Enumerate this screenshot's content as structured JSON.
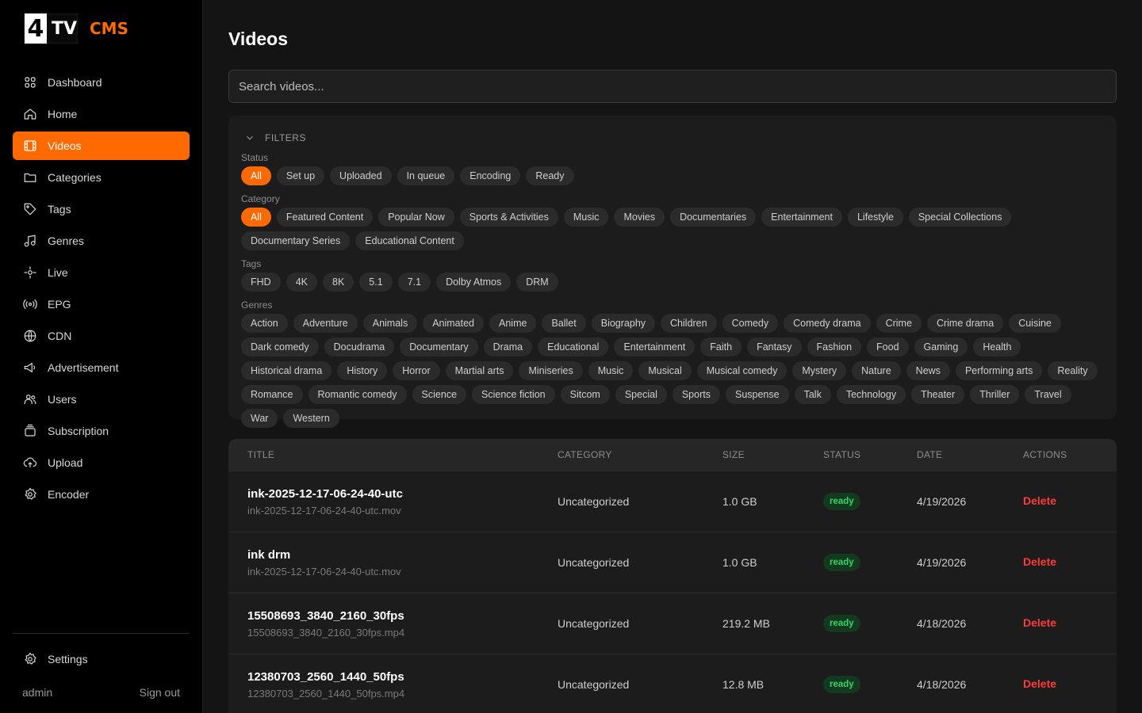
{
  "logo": {
    "mark": "4",
    "tv": "TV",
    "cms": "CMS"
  },
  "sidebar": {
    "items": [
      {
        "label": "Dashboard",
        "icon": "grid-icon",
        "active": false
      },
      {
        "label": "Home",
        "icon": "home-icon",
        "active": false
      },
      {
        "label": "Videos",
        "icon": "film-icon",
        "active": true
      },
      {
        "label": "Categories",
        "icon": "folder-icon",
        "active": false
      },
      {
        "label": "Tags",
        "icon": "tag-icon",
        "active": false
      },
      {
        "label": "Genres",
        "icon": "music-note-icon",
        "active": false
      },
      {
        "label": "Live",
        "icon": "live-signal-icon",
        "active": false
      },
      {
        "label": "EPG",
        "icon": "broadcast-icon",
        "active": false
      },
      {
        "label": "CDN",
        "icon": "globe-icon",
        "active": false
      },
      {
        "label": "Advertisement",
        "icon": "megaphone-icon",
        "active": false
      },
      {
        "label": "Users",
        "icon": "users-icon",
        "active": false
      },
      {
        "label": "Subscription",
        "icon": "stack-icon",
        "active": false
      },
      {
        "label": "Upload",
        "icon": "upload-cloud-icon",
        "active": false
      },
      {
        "label": "Encoder",
        "icon": "gear-icon",
        "active": false
      }
    ],
    "settings_label": "Settings",
    "user": "admin",
    "signout": "Sign out"
  },
  "page": {
    "title": "Videos",
    "search_placeholder": "Search videos..."
  },
  "filters": {
    "heading": "FILTERS",
    "status": {
      "label": "Status",
      "options": [
        "All",
        "Set up",
        "Uploaded",
        "In queue",
        "Encoding",
        "Ready"
      ],
      "active": "All"
    },
    "category": {
      "label": "Category",
      "options": [
        "All",
        "Featured Content",
        "Popular Now",
        "Sports & Activities",
        "Music",
        "Movies",
        "Documentaries",
        "Entertainment",
        "Lifestyle",
        "Special Collections",
        "Documentary Series",
        "Educational Content"
      ],
      "active": "All"
    },
    "tags": {
      "label": "Tags",
      "options": [
        "FHD",
        "4K",
        "8K",
        "5.1",
        "7.1",
        "Dolby Atmos",
        "DRM"
      ]
    },
    "genres": {
      "label": "Genres",
      "options": [
        "Action",
        "Adventure",
        "Animals",
        "Animated",
        "Anime",
        "Ballet",
        "Biography",
        "Children",
        "Comedy",
        "Comedy drama",
        "Crime",
        "Crime drama",
        "Cuisine",
        "Dark comedy",
        "Docudrama",
        "Documentary",
        "Drama",
        "Educational",
        "Entertainment",
        "Faith",
        "Fantasy",
        "Fashion",
        "Food",
        "Gaming",
        "Health",
        "Historical drama",
        "History",
        "Horror",
        "Martial arts",
        "Miniseries",
        "Music",
        "Musical",
        "Musical comedy",
        "Mystery",
        "Nature",
        "News",
        "Performing arts",
        "Reality",
        "Romance",
        "Romantic comedy",
        "Science",
        "Science fiction",
        "Sitcom",
        "Special",
        "Sports",
        "Suspense",
        "Talk",
        "Technology",
        "Theater",
        "Thriller",
        "Travel",
        "War",
        "Western"
      ]
    }
  },
  "table": {
    "headers": [
      "TITLE",
      "CATEGORY",
      "SIZE",
      "STATUS",
      "DATE",
      "ACTIONS"
    ],
    "rows": [
      {
        "title": "ink-2025-12-17-06-24-40-utc",
        "file": "ink-2025-12-17-06-24-40-utc.mov",
        "category": "Uncategorized",
        "size": "1.0 GB",
        "status": "ready",
        "date": "4/19/2026",
        "action": "Delete"
      },
      {
        "title": "ink drm",
        "file": "ink-2025-12-17-06-24-40-utc.mov",
        "category": "Uncategorized",
        "size": "1.0 GB",
        "status": "ready",
        "date": "4/19/2026",
        "action": "Delete"
      },
      {
        "title": "15508693_3840_2160_30fps",
        "file": "15508693_3840_2160_30fps.mp4",
        "category": "Uncategorized",
        "size": "219.2 MB",
        "status": "ready",
        "date": "4/18/2026",
        "action": "Delete"
      },
      {
        "title": "12380703_2560_1440_50fps",
        "file": "12380703_2560_1440_50fps.mp4",
        "category": "Uncategorized",
        "size": "12.8 MB",
        "status": "ready",
        "date": "4/18/2026",
        "action": "Delete"
      }
    ]
  },
  "colors": {
    "accent": "#ff6a00",
    "ready_bg": "#13391f",
    "ready_text": "#37d46a",
    "delete": "#ff3b3b"
  }
}
